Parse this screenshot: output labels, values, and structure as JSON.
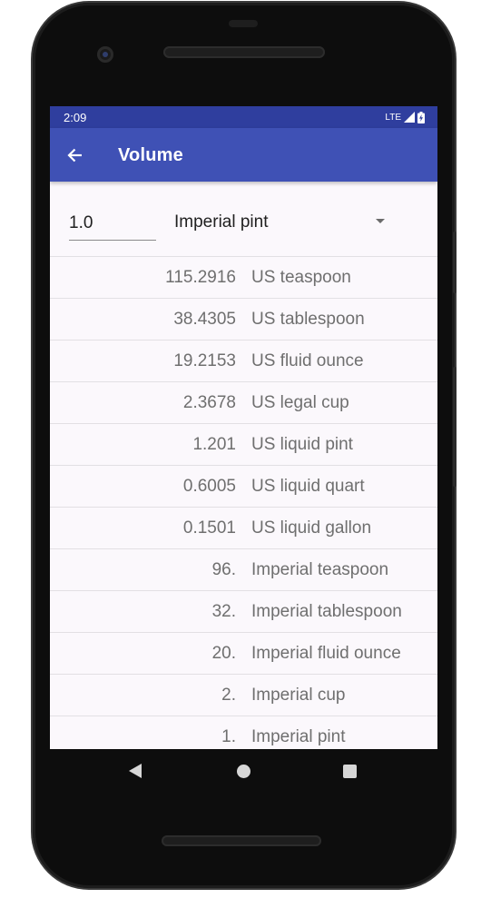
{
  "status_bar": {
    "time": "2:09",
    "network": "LTE"
  },
  "app_bar": {
    "title": "Volume",
    "back_icon": "arrow-back-icon",
    "background_color": "#3f51b5"
  },
  "converter": {
    "amount_value": "1.0",
    "selected_unit": "Imperial pint"
  },
  "results": [
    {
      "value": "115.2916",
      "unit": "US teaspoon"
    },
    {
      "value": "38.4305",
      "unit": "US tablespoon"
    },
    {
      "value": "19.2153",
      "unit": "US fluid ounce"
    },
    {
      "value": "2.3678",
      "unit": "US legal cup"
    },
    {
      "value": "1.201",
      "unit": "US liquid pint"
    },
    {
      "value": "0.6005",
      "unit": "US liquid quart"
    },
    {
      "value": "0.1501",
      "unit": "US liquid gallon"
    },
    {
      "value": "96.",
      "unit": "Imperial teaspoon"
    },
    {
      "value": "32.",
      "unit": "Imperial tablespoon"
    },
    {
      "value": "20.",
      "unit": "Imperial fluid ounce"
    },
    {
      "value": "2.",
      "unit": "Imperial cup"
    },
    {
      "value": "1.",
      "unit": "Imperial pint"
    }
  ],
  "nav_bar": {
    "icons": [
      "back-triangle-icon",
      "home-circle-icon",
      "recents-square-icon"
    ]
  }
}
